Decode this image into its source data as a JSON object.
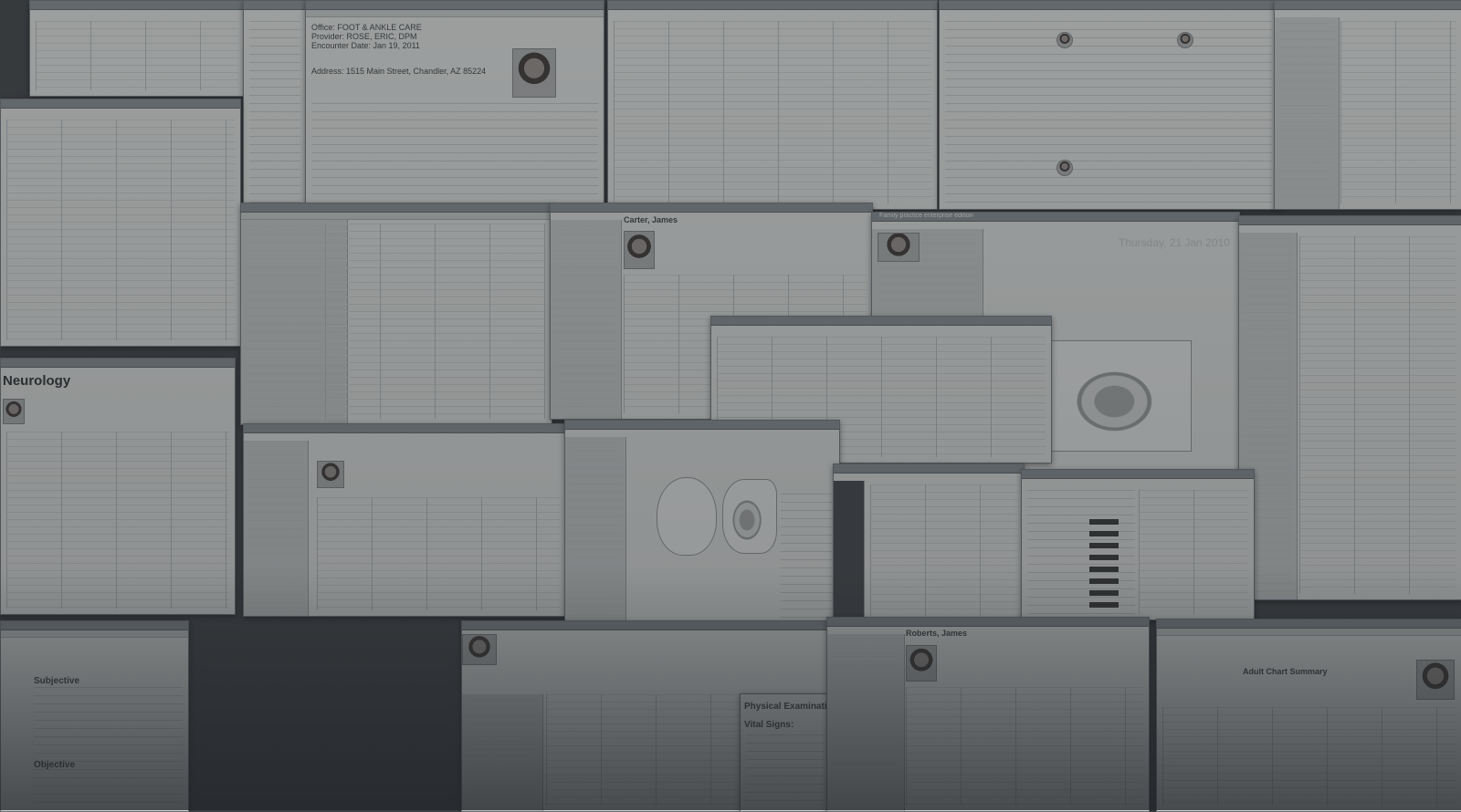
{
  "windows": {
    "neurology": {
      "title": "Neurology"
    },
    "demographics": {
      "line1": "Office: FOOT & ANKLE CARE",
      "line2": "Provider: ROSE, ERIC, DPM",
      "line3": "Encounter Date: Jan 19, 2011",
      "line4": "Address: 1515 Main Street, Chandler, AZ 85224"
    },
    "intake": {
      "title": "Family practice enterprise edition",
      "date": "Thursday, 21 Jan 2010"
    },
    "patient_card": {
      "name": "Carter, James"
    },
    "exam": {
      "title": "Physical Examination:",
      "subtitle": "Vital Signs:"
    },
    "chart_summary": {
      "title": "Adult Chart Summary"
    },
    "notes": {
      "heading": "Subjective",
      "heading2": "Objective"
    },
    "patient2": {
      "name": "Roberts, James"
    }
  }
}
